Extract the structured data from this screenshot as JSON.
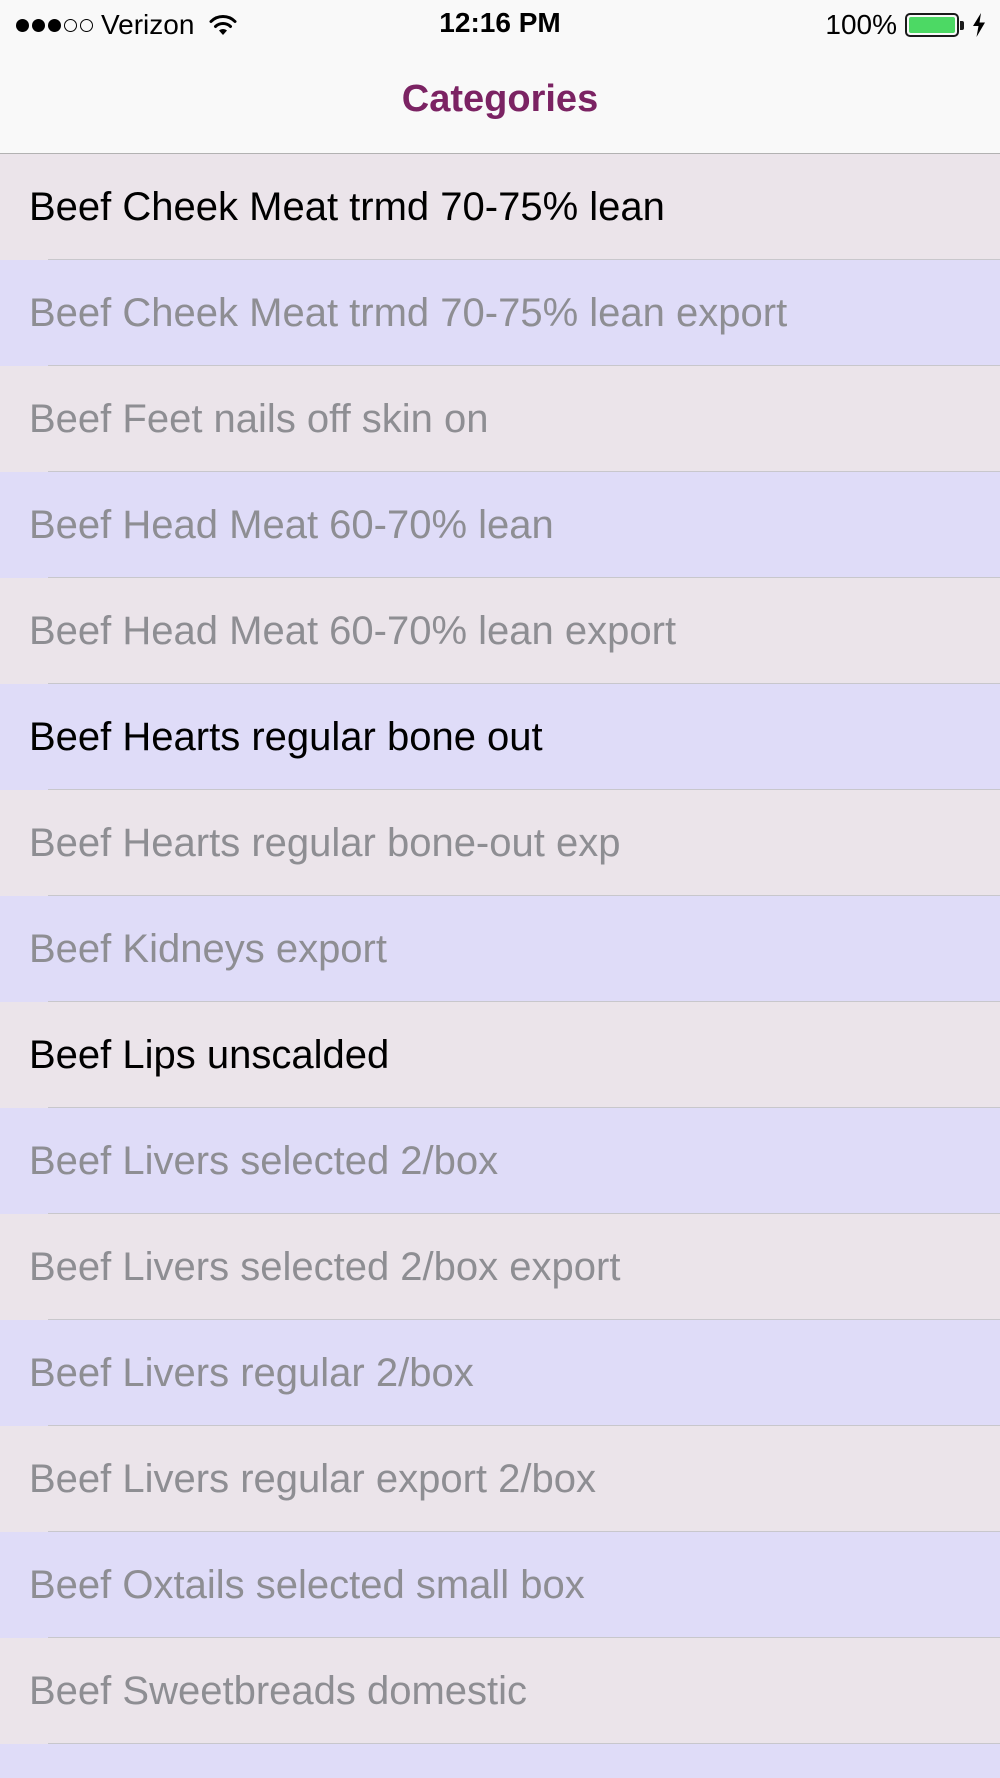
{
  "status_bar": {
    "carrier": "Verizon",
    "time": "12:16 PM",
    "battery_percent": "100%",
    "signal_bars_filled": 3,
    "signal_bars_total": 5
  },
  "nav": {
    "title": "Categories"
  },
  "colors": {
    "title": "#7b2363",
    "row_odd": "#ebe4ea",
    "row_even": "#dfdcf8",
    "active_text": "#000000",
    "dimmed_text": "#8e8e93",
    "battery": "#4cd964"
  },
  "categories": [
    {
      "label": "Beef Cheek Meat trmd 70-75% lean",
      "active": true
    },
    {
      "label": "Beef Cheek Meat trmd 70-75% lean export",
      "active": false
    },
    {
      "label": "Beef Feet nails off skin on",
      "active": false
    },
    {
      "label": "Beef Head Meat 60-70% lean",
      "active": false
    },
    {
      "label": "Beef Head Meat 60-70% lean export",
      "active": false
    },
    {
      "label": "Beef Hearts regular bone out",
      "active": true
    },
    {
      "label": "Beef Hearts regular bone-out exp",
      "active": false
    },
    {
      "label": "Beef Kidneys export",
      "active": false
    },
    {
      "label": "Beef Lips unscalded",
      "active": true
    },
    {
      "label": "Beef Livers selected 2/box",
      "active": false
    },
    {
      "label": "Beef Livers selected 2/box export",
      "active": false
    },
    {
      "label": "Beef Livers regular 2/box",
      "active": false
    },
    {
      "label": "Beef Livers regular export 2/box",
      "active": false
    },
    {
      "label": "Beef Oxtails selected small box",
      "active": false
    },
    {
      "label": "Beef Sweetbreads domestic",
      "active": false
    },
    {
      "label": "",
      "active": false
    }
  ]
}
